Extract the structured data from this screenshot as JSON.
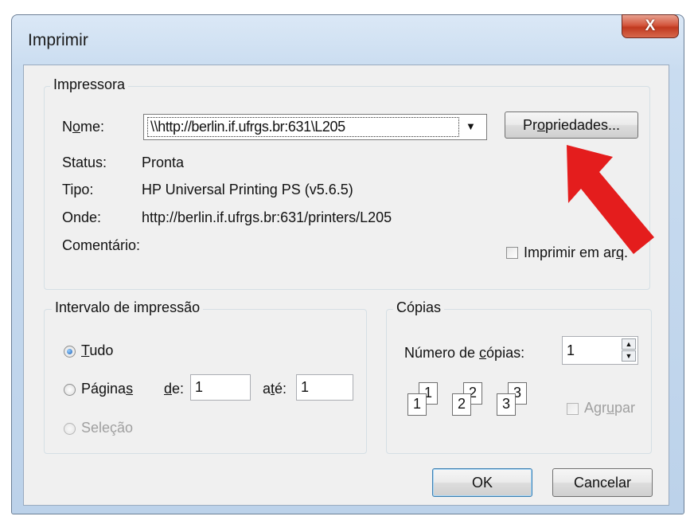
{
  "window": {
    "title": "Imprimir",
    "close_glyph": "X"
  },
  "printer_group": {
    "legend": "Impressora",
    "name_label_pre": "N",
    "name_label_access": "o",
    "name_label_post": "me:",
    "name_value": "\\\\http://berlin.if.ufrgs.br:631\\L205",
    "properties_pre": "Pr",
    "properties_access": "o",
    "properties_post": "priedades...",
    "status_label": "Status:",
    "status_value": "Pronta",
    "type_label": "Tipo:",
    "type_value": "HP Universal Printing PS (v5.6.5)",
    "where_label": "Onde:",
    "where_value": "http://berlin.if.ufrgs.br:631/printers/L205",
    "comment_label": "Comentário:",
    "print_to_file_pre": "Imprimir em ar",
    "print_to_file_access": "q",
    "print_to_file_post": ".",
    "print_to_file_checked": false
  },
  "range_group": {
    "legend": "Intervalo de impressão",
    "all_access": "T",
    "all_post": "udo",
    "all_selected": true,
    "pages_pre": "Página",
    "pages_access": "s",
    "from_access": "d",
    "from_post": "e:",
    "from_value": "1",
    "to_pre": "a",
    "to_access": "t",
    "to_post": "é:",
    "to_value": "1",
    "selection_label": "Seleção"
  },
  "copies_group": {
    "legend": "Cópias",
    "count_pre": "Número de ",
    "count_access": "c",
    "count_post": "ópias:",
    "count_value": "1",
    "collate_pre": "Agr",
    "collate_access": "u",
    "collate_post": "par",
    "collate_checked": false,
    "collate_icon": {
      "sets": [
        {
          "front": "1",
          "back": "1"
        },
        {
          "front": "2",
          "back": "2"
        },
        {
          "front": "3",
          "back": "3"
        }
      ]
    }
  },
  "buttons": {
    "ok": "OK",
    "cancel": "Cancelar"
  },
  "annotation": {
    "arrow_color": "#e41d1d"
  },
  "colors": {
    "default_button_border": "#3c7fb1",
    "window_frame": "#c9dcf0"
  }
}
